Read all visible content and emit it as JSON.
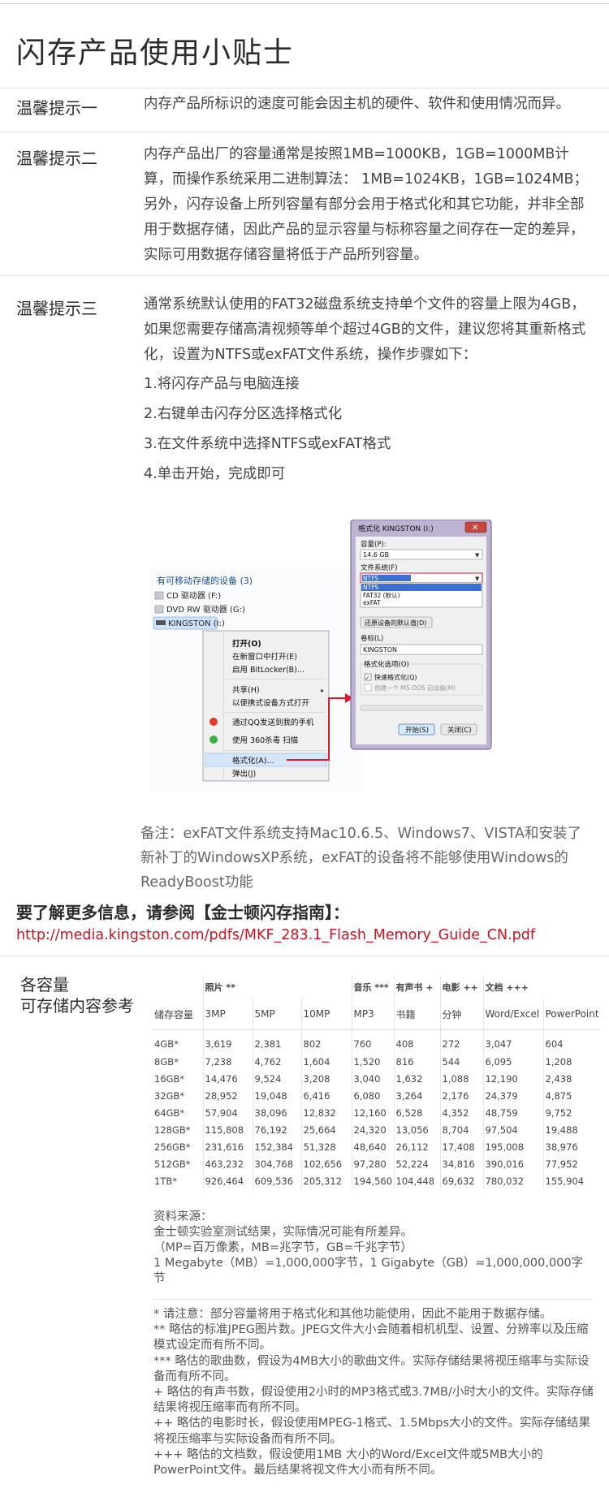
{
  "title": "闪存产品使用小贴士",
  "tips": [
    {
      "label": "温馨提示一",
      "body": "内存产品所标识的速度可能会因主机的硬件、软件和使用情况而异。"
    },
    {
      "label": "温馨提示二",
      "body": "内存产品出厂的容量通常是按照1MB=1000KB，1GB=1000MB计算，而操作系统采用二进制算法： 1MB=1024KB，1GB=1024MB；另外，闪存设备上所列容量有部分会用于格式化和其它功能，并非全部用于数据存储，因此产品的显示容量与标称容量之间存在一定的差异，实际可用数据存储容量将低于产品所列容量。"
    },
    {
      "label": "温馨提示三",
      "body": "通常系统默认使用的FAT32磁盘系统支持单个文件的容量上限为4GB，如果您需要存储高清视频等单个超过4GB的文件，建议您将其重新格式化，设置为NTFS或exFAT文件系统，操作步骤如下：",
      "steps": [
        "1.将闪存产品与电脑连接",
        "2.右键单击闪存分区选择格式化",
        "3.在文件系统中选择NTFS或exFAT格式",
        "4.单击开始，完成即可"
      ]
    }
  ],
  "screenshot": {
    "explorer": {
      "header": "有可移动存储的设备 (3)",
      "drives": [
        "CD 驱动器 (F:)",
        "DVD RW 驱动器 (G:)",
        "KINGSTON (I:)"
      ],
      "menu": [
        "打开(O)",
        "在新窗口中打开(E)",
        "启用 BitLocker(B)...",
        "共享(H)",
        "以便携式设备方式打开",
        "通过QQ发送到我的手机",
        "使用 360杀毒 扫描",
        "格式化(A)...",
        "弹出(J)"
      ]
    },
    "dialog": {
      "title": "格式化 KINGSTON (I:)",
      "capacity_label": "容量(P):",
      "capacity_value": "14.6 GB",
      "fs_label": "文件系统(F)",
      "fs_value": "NTFS",
      "fs_options": [
        "NTFS",
        "FAT32 (默认)",
        "exFAT"
      ],
      "restore_button": "还原设备的默认值(D)",
      "volume_label": "卷标(L)",
      "volume_value": "KINGSTON",
      "options_label": "格式化选项(O)",
      "quick_format": "快速格式化(Q)",
      "msdos": "创建一个 MS-DOS 启动盘(M)",
      "start_button": "开始(S)",
      "close_button": "关闭(C)"
    }
  },
  "note": "备注：exFAT文件系统支持Mac10.6.5、Windows7、VISTA和安装了新补丁的WindowsXP系统，exFAT的设备将不能够使用Windows的ReadyBoost功能",
  "more": {
    "title": "要了解更多信息，请参阅【金士顿闪存指南】：",
    "link": "http://media.kingston.com/pdfs/MKF_283.1_Flash_Memory_Guide_CN.pdf"
  },
  "capacity_table": {
    "side_title_1": "各容量",
    "side_title_2": "可存储内容参考",
    "groups": [
      "照片 **",
      "音乐 ***",
      "有声书 +",
      "电影 ++",
      "文档 +++"
    ],
    "storage_header": "储存容量",
    "columns": [
      "3MP",
      "5MP",
      "10MP",
      "MP3",
      "书籍",
      "分钟",
      "Word/Excel",
      "PowerPoint"
    ],
    "rows": [
      [
        "4GB*",
        "3,619",
        "2,381",
        "802",
        "760",
        "408",
        "272",
        "3,047",
        "604"
      ],
      [
        "8GB*",
        "7,238",
        "4,762",
        "1,604",
        "1,520",
        "816",
        "544",
        "6,095",
        "1,208"
      ],
      [
        "16GB*",
        "14,476",
        "9,524",
        "3,208",
        "3,040",
        "1,632",
        "1,088",
        "12,190",
        "2,438"
      ],
      [
        "32GB*",
        "28,952",
        "19,048",
        "6,416",
        "6,080",
        "3,264",
        "2,176",
        "24,379",
        "4,875"
      ],
      [
        "64GB*",
        "57,904",
        "38,096",
        "12,832",
        "12,160",
        "6,528",
        "4,352",
        "48,759",
        "9,752"
      ],
      [
        "128GB*",
        "115,808",
        "76,192",
        "25,664",
        "24,320",
        "13,056",
        "8,704",
        "97,504",
        "19,488"
      ],
      [
        "256GB*",
        "231,616",
        "152,384",
        "51,328",
        "48,640",
        "26,112",
        "17,408",
        "195,008",
        "38,976"
      ],
      [
        "512GB*",
        "463,232",
        "304,768",
        "102,656",
        "97,280",
        "52,224",
        "34,816",
        "390,016",
        "77,952"
      ],
      [
        "1TB*",
        "926,464",
        "609,536",
        "205,312",
        "194,560",
        "104,448",
        "69,632",
        "780,032",
        "155,904"
      ]
    ]
  },
  "source": [
    "资料来源：",
    "金士顿实验室测试结果，实际情况可能有所差异。",
    "（MP=百万像素，MB=兆字节，GB=千兆字节）",
    "1 Megabyte（MB）=1,000,000字节，1 Gigabyte（GB）=1,000,000,000字节"
  ],
  "footnotes": [
    "* 请注意：部分容量将用于格式化和其他功能使用，因此不能用于数据存储。",
    "** 略估的标准JPEG图片数。JPEG文件大小会随着相机机型、设置、分辨率以及压缩模式设定而有所不同。",
    "*** 略估的歌曲数，假设为4MB大小的歌曲文件。实际存储结果将视压缩率与实际设备而有所不同。",
    "+ 略估的有声书数，假设使用2小时的MP3格式或3.7MB/小时大小的文件。实际存储结果将视压缩率而有所不同。",
    "++ 略估的电影时长，假设使用MPEG-1格式、1.5Mbps大小的文件。实际存储结果将视压缩率与实际设备而有所不同。",
    "+++ 略估的文档数，假设使用1MB 大小的Word/Excel文件或5MB大小的PowerPoint文件。最后结果将视文件大小而有所不同。"
  ]
}
